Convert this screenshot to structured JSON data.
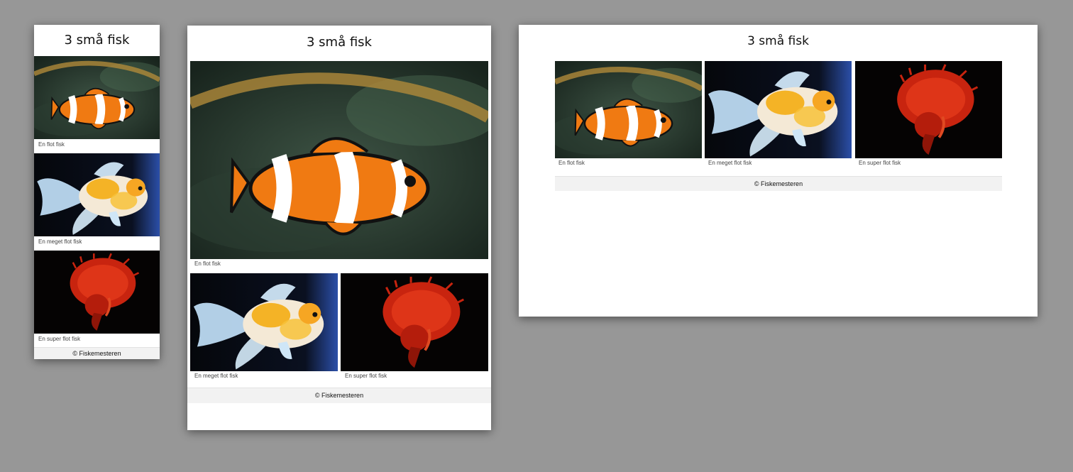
{
  "page_title": "3 små fisk",
  "footer_text": "© Fiskemesteren",
  "photos": [
    {
      "kind": "clownfish-photo",
      "caption": "En flot fisk"
    },
    {
      "kind": "goldfish-photo",
      "caption": "En meget flot fisk"
    },
    {
      "kind": "betta-fish-photo",
      "caption": "En super flot fisk"
    }
  ],
  "colors": {
    "backdrop": "#979797",
    "page": "#ffffff",
    "footer_bg": "#f2f2f2",
    "clownfish_orange": "#f07a12",
    "betta_red": "#d42b14"
  }
}
